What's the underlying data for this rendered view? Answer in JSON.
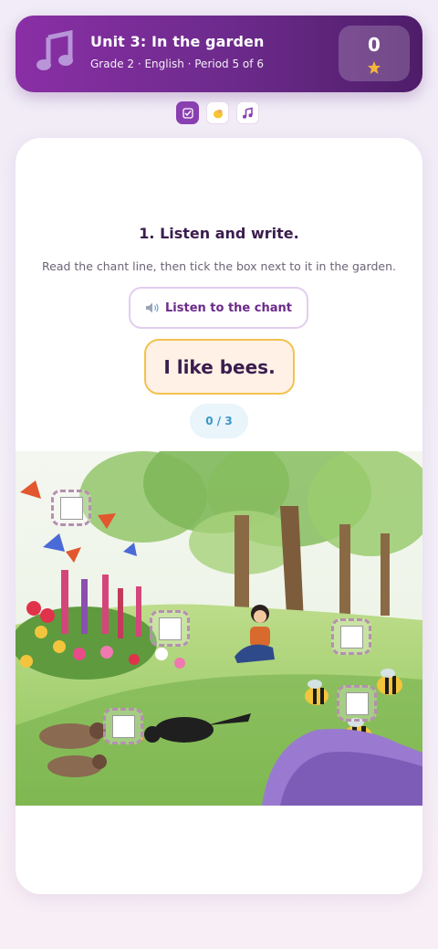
{
  "header": {
    "icon": "music-note-icon",
    "title": "Unit 3: In the garden",
    "subtitle": "Grade 2 · English · Period 5 of 6",
    "score": "0",
    "score_icon": "star-icon"
  },
  "tabs": [
    {
      "icon": "checkbox-icon",
      "active": true
    },
    {
      "icon": "lemon-icon",
      "active": false
    },
    {
      "icon": "music-note-icon",
      "active": false
    }
  ],
  "question": {
    "title": "1. Listen and write.",
    "instruction": "Read the chant line, then tick the box next to it in the garden.",
    "listen_label": "Listen to the chant",
    "listen_icon": "speaker-icon",
    "phrase": "I like bees.",
    "progress": "0 / 3"
  },
  "scene": {
    "description_items": [
      "butterflies",
      "flowers",
      "girl",
      "bees",
      "birds"
    ],
    "tick_boxes": [
      "butterflies",
      "flowers",
      "girl",
      "bees",
      "birds"
    ]
  },
  "colors": {
    "brand": "#7a2d9a",
    "accent_yellow": "#f3c24f",
    "progress_blue": "#3a96c8"
  }
}
